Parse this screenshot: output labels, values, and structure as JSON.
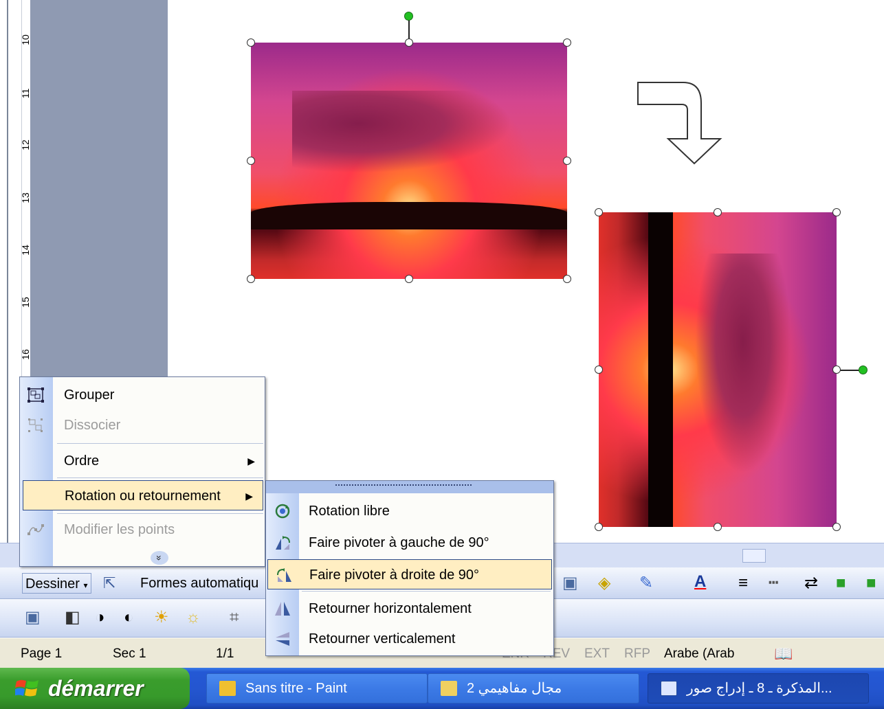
{
  "ruler": {
    "numbers": [
      "10",
      "11",
      "12",
      "13",
      "14",
      "15",
      "16"
    ]
  },
  "context_menu": {
    "items": [
      {
        "label": "Grouper",
        "enabled": true,
        "submenu": false
      },
      {
        "label": "Dissocier",
        "enabled": false,
        "submenu": false
      },
      {
        "label": "Ordre",
        "enabled": true,
        "submenu": true
      },
      {
        "label": "Rotation ou retournement",
        "enabled": true,
        "submenu": true,
        "highlighted": true
      },
      {
        "label": "Modifier les points",
        "enabled": false,
        "submenu": false
      }
    ],
    "expand_glyph": "»"
  },
  "submenu": {
    "items": [
      {
        "label": "Rotation libre"
      },
      {
        "label": "Faire pivoter à gauche de 90°"
      },
      {
        "label": "Faire pivoter à droite de 90°",
        "highlighted": true
      },
      {
        "label": "Retourner horizontalement"
      },
      {
        "label": "Retourner verticalement"
      }
    ]
  },
  "draw_toolbar": {
    "dessiner": "Dessiner",
    "formes": "Formes automatiqu"
  },
  "statusbar": {
    "page": "Page 1",
    "sec": "Sec 1",
    "pages": "1/1",
    "enr": "ENR",
    "rev": "REV",
    "ext": "EXT",
    "rfp": "RFP",
    "lang": "Arabe (Arab"
  },
  "taskbar": {
    "start": "démarrer",
    "tasks": [
      {
        "label": "Sans titre - Paint"
      },
      {
        "label": "مجال مفاهيمي 2"
      },
      {
        "label": "...المذكرة ـ 8 ـ إدراج صور"
      }
    ]
  },
  "colors": {
    "accent": "#2456d0",
    "menu_highlight": "#ffeec2",
    "start_green": "#3a9d2c"
  }
}
